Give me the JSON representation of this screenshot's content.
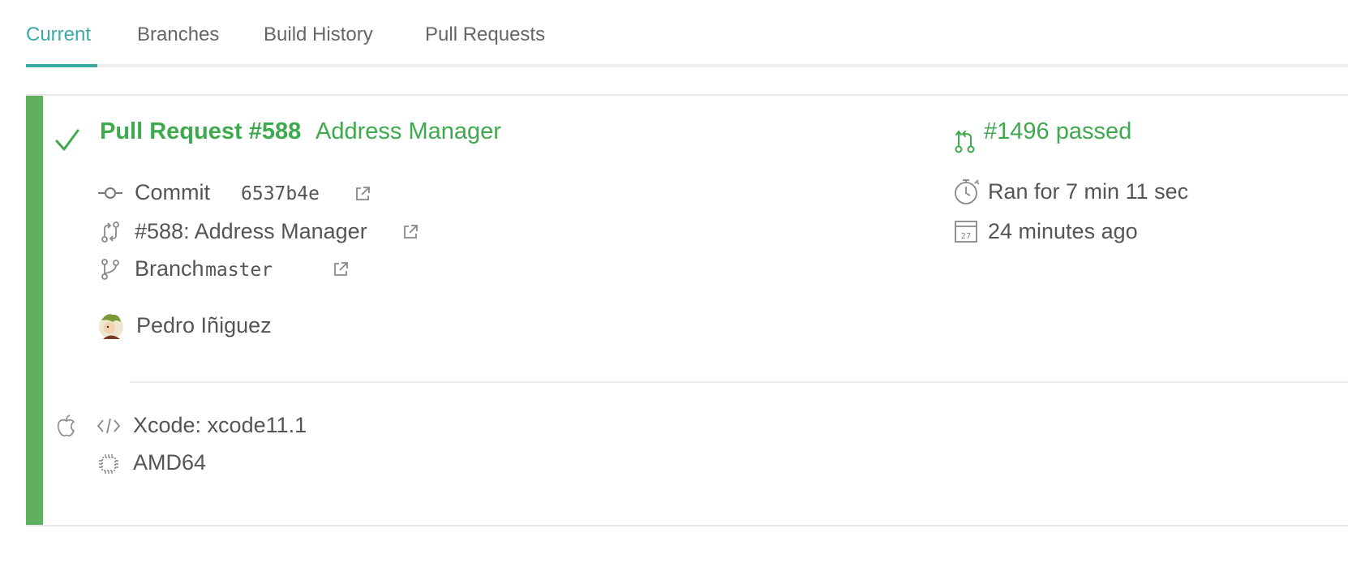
{
  "tabs": [
    {
      "label": "Current",
      "active": true
    },
    {
      "label": "Branches",
      "active": false
    },
    {
      "label": "Build History",
      "active": false
    },
    {
      "label": "Pull Requests",
      "active": false
    }
  ],
  "build": {
    "status": "passed",
    "status_color": "#3daa4e",
    "title": "Pull Request #588",
    "subtitle": "Address Manager",
    "build_status_text": "#1496 passed",
    "commit_label": "Commit",
    "commit_sha": "6537b4e",
    "pr_text": "#588: Address Manager",
    "branch_label": "Branch",
    "branch_name": "master",
    "author": "Pedro Iñiguez",
    "duration": "Ran for 7 min 11 sec",
    "finished": "24 minutes ago",
    "calendar_day": "27",
    "os_icon": "apple-icon",
    "xcode": "Xcode: xcode11.1",
    "arch": "AMD64"
  },
  "colors": {
    "accent": "#39aaa4",
    "passed": "#3daa4e",
    "bar": "#5fb15f"
  }
}
